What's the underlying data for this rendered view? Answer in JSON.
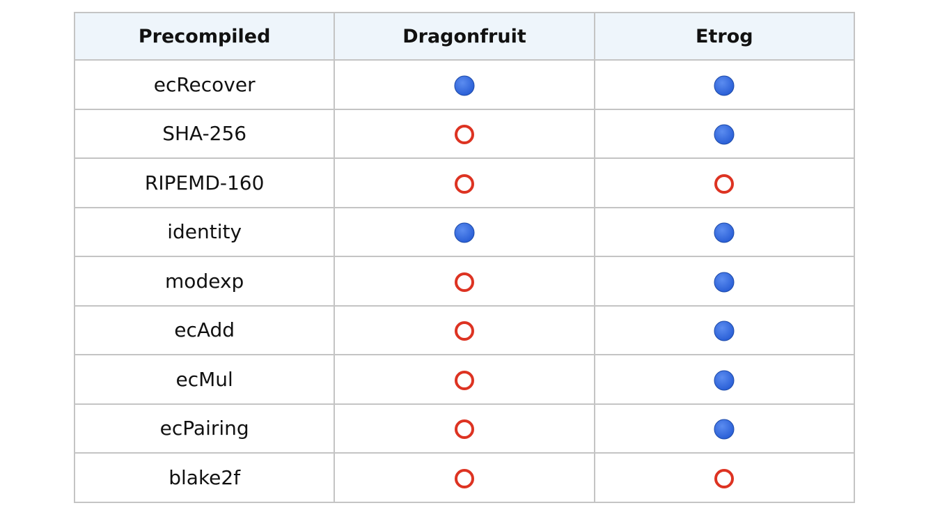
{
  "table": {
    "headers": [
      "Precompiled",
      "Dragonfruit",
      "Etrog"
    ],
    "rows": [
      {
        "name": "ecRecover",
        "dragonfruit": "supported",
        "etrog": "supported"
      },
      {
        "name": "SHA-256",
        "dragonfruit": "unsupported",
        "etrog": "supported"
      },
      {
        "name": "RIPEMD-160",
        "dragonfruit": "unsupported",
        "etrog": "unsupported"
      },
      {
        "name": "identity",
        "dragonfruit": "supported",
        "etrog": "supported"
      },
      {
        "name": "modexp",
        "dragonfruit": "unsupported",
        "etrog": "supported"
      },
      {
        "name": "ecAdd",
        "dragonfruit": "unsupported",
        "etrog": "supported"
      },
      {
        "name": "ecMul",
        "dragonfruit": "unsupported",
        "etrog": "supported"
      },
      {
        "name": "ecPairing",
        "dragonfruit": "unsupported",
        "etrog": "supported"
      },
      {
        "name": "blake2f",
        "dragonfruit": "unsupported",
        "etrog": "unsupported"
      }
    ]
  },
  "icons": {
    "supported": "blue-circle-icon",
    "unsupported": "red-hollow-circle-icon"
  },
  "colors": {
    "header_bg": "#eef5fb",
    "grid": "#c4c4c4",
    "supported_fill": "#2a5fd6",
    "unsupported_stroke": "#dd3322"
  }
}
